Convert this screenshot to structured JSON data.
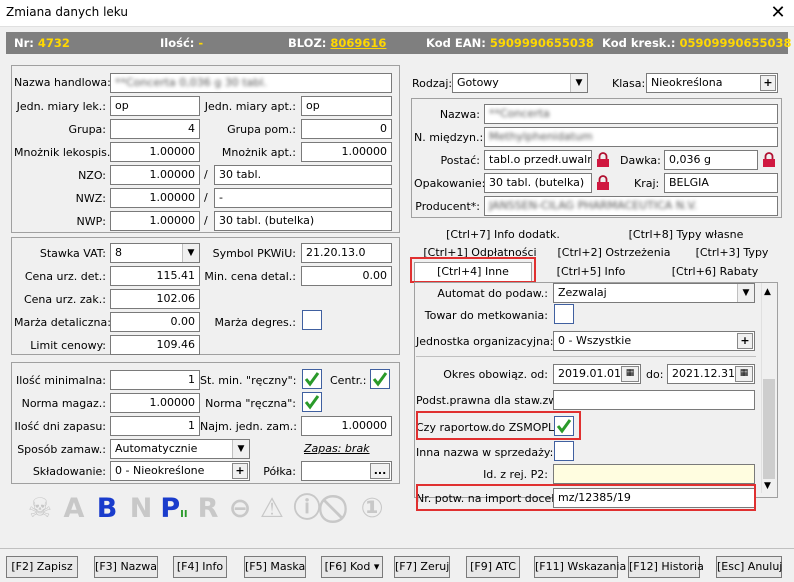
{
  "window": {
    "title": "Zmiana danych leku"
  },
  "info": {
    "nr_label": "Nr:",
    "nr_value": "4732",
    "ilosc_label": "Ilość:",
    "ilosc_value": "-",
    "bloz_label": "BLOZ:",
    "bloz_value": "8069616",
    "ean_label": "Kod EAN:",
    "ean_value": "5909990655038",
    "kreskowy_label": "Kod kresk.:",
    "kreskowy_value": "05909990655038"
  },
  "left_top": {
    "nazwa_handlowa_label": "Nazwa handlowa:",
    "nazwa_handlowa_value": "**Concerta 0,036 g 30 tabl.",
    "jedn_lek_label": "Jedn. miary lek.:",
    "jedn_lek_value": "op",
    "jedn_apt_label": "Jedn. miary apt.:",
    "jedn_apt_value": "op",
    "grupa_label": "Grupa:",
    "grupa_value": "4",
    "grupa_pom_label": "Grupa pom.:",
    "grupa_pom_value": "0",
    "mnoznik_lek_label": "Mnożnik lekospis.:",
    "mnoznik_lek_value": "1.00000",
    "mnoznik_apt_label": "Mnożnik apt.:",
    "mnoznik_apt_value": "1.00000",
    "nzo_label": "NZO:",
    "nzo_value": "1.00000",
    "nzo_text": "30 tabl.",
    "nwz_label": "NWZ:",
    "nwz_value": "1.00000",
    "nwz_text": "-",
    "nwp_label": "NWP:",
    "nwp_value": "1.00000",
    "nwp_text": "30 tabl. (butelka)",
    "slash": "/"
  },
  "left_mid": {
    "vat_label": "Stawka VAT:",
    "vat_value": "8",
    "pkwiu_label": "Symbol PKWiU:",
    "pkwiu_value": "21.20.13.0",
    "cena_det_label": "Cena urz. det.:",
    "cena_det_value": "115.41",
    "min_cena_label": "Min. cena detal.:",
    "min_cena_value": "0.00",
    "cena_zak_label": "Cena urz. zak.:",
    "cena_zak_value": "102.06",
    "marza_det_label": "Marża detaliczna:",
    "marza_det_value": "0.00",
    "marza_degres_label": "Marża degres.:",
    "limit_label": "Limit cenowy:",
    "limit_value": "109.46"
  },
  "left_bot": {
    "ilosc_min_label": "Ilość minimalna:",
    "ilosc_min_value": "1",
    "st_min_label": "St. min. \"ręczny\":",
    "centr_label": "Centr.:",
    "norma_mag_label": "Norma magaz.:",
    "norma_mag_value": "1.00000",
    "norma_reczna_label": "Norma \"ręczna\":",
    "dni_zapasu_label": "Ilość dni zapasu:",
    "dni_zapasu_value": "1",
    "najm_jedn_label": "Najm. jedn. zam.:",
    "najm_jedn_value": "1.00000",
    "sposob_label": "Sposób zamaw.:",
    "sposob_value": "Automatycznie",
    "zapas_link": "Zapas: brak",
    "skladowanie_label": "Składowanie:",
    "skladowanie_value": "0 - Nieokreślone",
    "polka_label": "Półka:",
    "polka_btn": "..."
  },
  "right_top": {
    "rodzaj_label": "Rodzaj:",
    "rodzaj_value": "Gotowy",
    "klasa_label": "Klasa:",
    "klasa_value": "Nieokreślona",
    "nazwa_label": "Nazwa:",
    "nazwa_value": "**Concerta",
    "miedzyn_label": "N. międzyn.:",
    "miedzyn_value": "Methylphenidatum",
    "postac_label": "Postać:",
    "postac_value": "tabl.o przedł.uwaln.",
    "dawka_label": "Dawka:",
    "dawka_value": "0,036 g",
    "opakowanie_label": "Opakowanie:",
    "opakowanie_value": "30 tabl. (butelka)",
    "kraj_label": "Kraj:",
    "kraj_value": "BELGIA",
    "producent_label": "Producent*:",
    "producent_value": "JANSSEN-CILAG PHARMACEUTICA N.V."
  },
  "tabs": {
    "row1": [
      "[Ctrl+7] Info dodatk.",
      "[Ctrl+8] Typy własne"
    ],
    "row2": [
      "[Ctrl+1] Odpłatności",
      "[Ctrl+2] Ostrzeżenia",
      "[Ctrl+3] Typy"
    ],
    "row3": [
      "[Ctrl+4] Inne",
      "[Ctrl+5] Info",
      "[Ctrl+6] Rabaty"
    ]
  },
  "inne": {
    "automat_label": "Automat do podaw.:",
    "automat_value": "Zezwalaj",
    "towar_label": "Towar do metkowania:",
    "jednostka_label": "Jednostka organizacyjna:",
    "jednostka_value": "0 - Wszystkie",
    "okres_label": "Okres obowiąz. od:",
    "okres_od": "2019.01.01",
    "do_label": "do:",
    "okres_do": "2021.12.31",
    "podst_label": "Podst.prawna dla staw.zw:",
    "zsmopl_label": "Czy raportow.do ZSMOPL:",
    "inna_nazwa_label": "Inna nazwa w sprzedaży:",
    "id_rej_label": "Id. z rej. P2:",
    "nr_potw_label": "Nr. potw. na import docel.:",
    "nr_potw_value": "mz/12385/19"
  },
  "icons": [
    "skull-icon",
    "letter-a-icon",
    "letter-b-icon",
    "letter-n-icon",
    "letter-p-ii-icon",
    "letter-r-icon",
    "no-entry-icon",
    "warning-triangle-icon",
    "info-warning-icon",
    "number-one-icon"
  ],
  "footer": {
    "zapisz": "[F2] Zapisz",
    "nazwa": "[F3] Nazwa",
    "info": "[F4] Info",
    "maska": "[F5] Maska",
    "kod": "[F6] Kod",
    "zeruj": "[F7] Zeruj",
    "atc": "[F9] ATC",
    "wskazania": "[F11] Wskazania",
    "historia": "[F12] Historia",
    "anuluj": "[Esc] Anuluj"
  },
  "colors": {
    "highlight_red": "#e03030",
    "info_bg": "#7f7f7f",
    "info_value": "#ffd800",
    "check_green": "#2a9a2a",
    "accent_blue": "#1a3ccc"
  }
}
